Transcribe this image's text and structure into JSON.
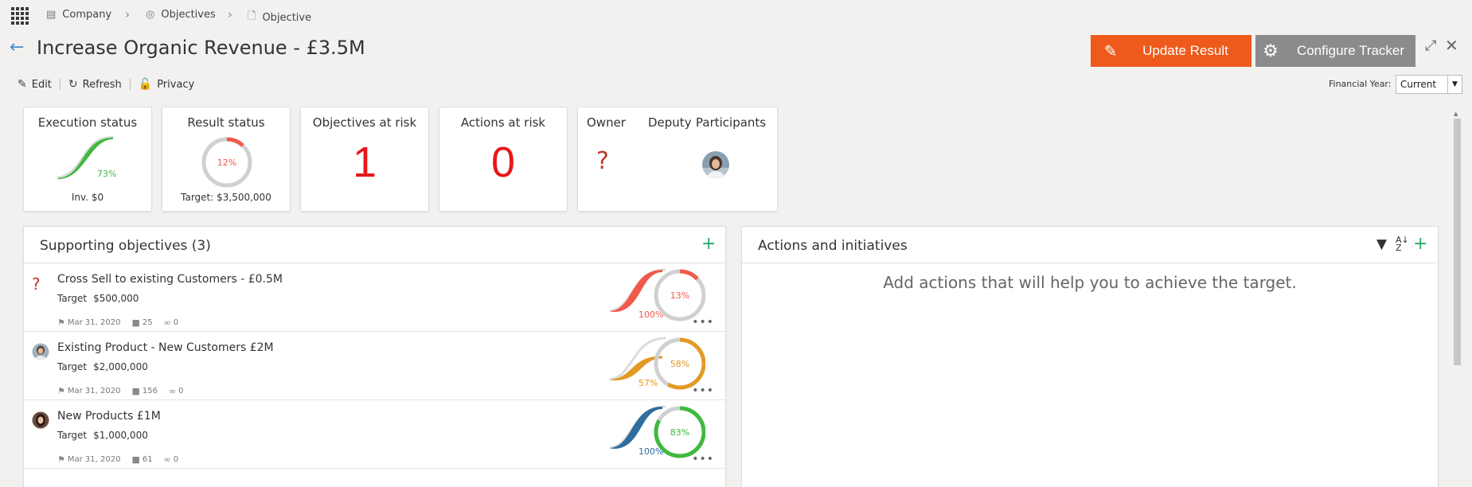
{
  "breadcrumb": [
    {
      "label": "Company",
      "icon": "company-icon"
    },
    {
      "label": "Objectives",
      "icon": "objectives-icon"
    },
    {
      "label": "Objective",
      "icon": "document-icon"
    }
  ],
  "header": {
    "title": "Increase Organic Revenue - £3.5M",
    "update_label": "Update Result",
    "config_label": "Configure Tracker"
  },
  "toolbar": {
    "edit_label": "Edit",
    "refresh_label": "Refresh",
    "privacy_label": "Privacy",
    "financial_year_label": "Financial Year:",
    "financial_year_value": "Current"
  },
  "cards": {
    "execution": {
      "title": "Execution status",
      "percent_label": "73%",
      "percent": 73,
      "footer": "Inv. $0",
      "color": "#3fb93f"
    },
    "result": {
      "title": "Result status",
      "percent_label": "12%",
      "percent": 12,
      "footer": "Target: $3,500,000",
      "color": "#f05a4a"
    },
    "objectives_at_risk": {
      "title": "Objectives at risk",
      "value": "1"
    },
    "actions_at_risk": {
      "title": "Actions at risk",
      "value": "0"
    },
    "people": {
      "owner_label": "Owner",
      "deputy_label": "Deputy",
      "participants_label": "Participants",
      "owner_value": "?"
    }
  },
  "supporting": {
    "title": "Supporting objectives (3)",
    "target_label": "Target",
    "items": [
      {
        "name": "Cross Sell to existing Customers - £0.5M",
        "target": "$500,000",
        "date": "Mar 31, 2020",
        "comments": "25",
        "attachments": "0",
        "exec_label": "100%",
        "exec": 100,
        "result_label": "13%",
        "result": 13,
        "exec_color": "#f05a4a",
        "result_color": "#f05a4a",
        "owner": "unknown"
      },
      {
        "name": "Existing Product - New Customers £2M",
        "target": "$2,000,000",
        "date": "Mar 31, 2020",
        "comments": "156",
        "attachments": "0",
        "exec_label": "57%",
        "exec": 57,
        "result_label": "58%",
        "result": 58,
        "exec_color": "#e39a24",
        "result_color": "#e39a24",
        "owner": "avatar"
      },
      {
        "name": "New Products £1M",
        "target": "$1,000,000",
        "date": "Mar 31, 2020",
        "comments": "61",
        "attachments": "0",
        "exec_label": "100%",
        "exec": 100,
        "result_label": "83%",
        "result": 83,
        "exec_color": "#2f6e9f",
        "result_color": "#3fb93f",
        "owner": "avatar"
      }
    ]
  },
  "actions": {
    "title": "Actions and initiatives",
    "empty_message": "Add actions that will help you to achieve the target."
  }
}
